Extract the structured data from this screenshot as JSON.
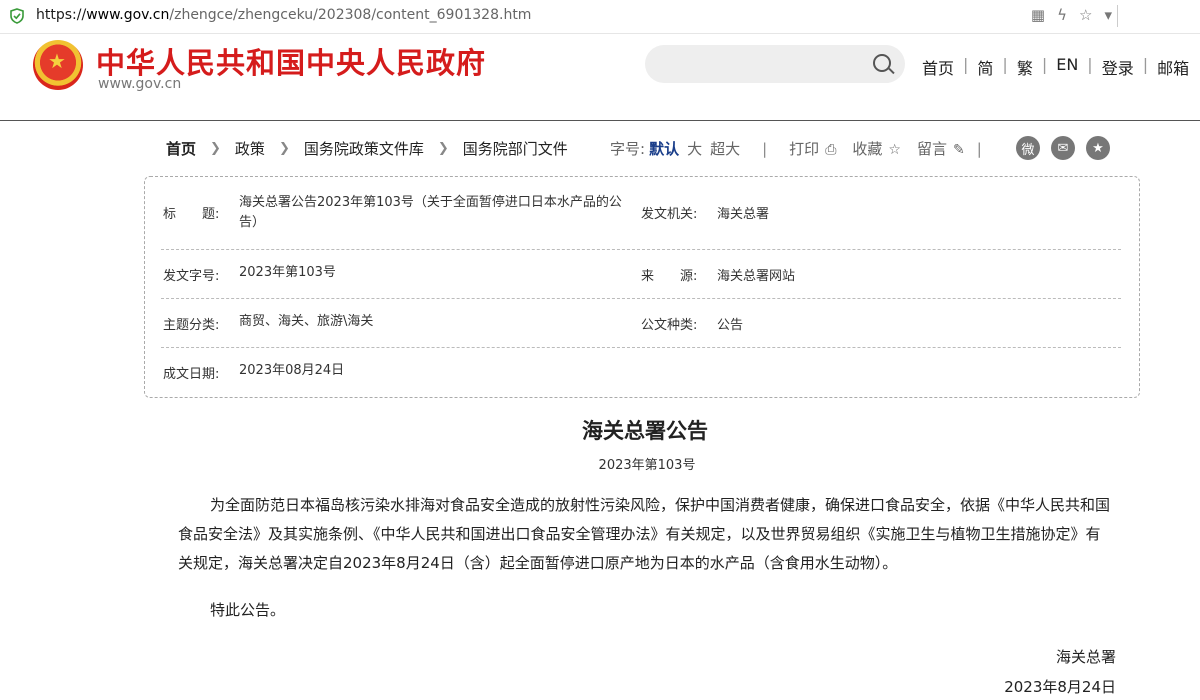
{
  "browser": {
    "url_scheme": "https://",
    "url_host": "www.gov.cn",
    "url_path": "/zhengce/zhengceku/202308/content_6901328.htm"
  },
  "header": {
    "site_title": "中华人民共和国中央人民政府",
    "domain": "www.gov.cn",
    "search_placeholder": "",
    "links": [
      "首页",
      "简",
      "繁",
      "EN",
      "登录",
      "邮箱"
    ],
    "separator": "|"
  },
  "breadcrumb": [
    "首页",
    "政策",
    "国务院政策文件库",
    "国务院部门文件"
  ],
  "tools": {
    "font_label": "字号:",
    "font_default": "默认",
    "font_large": "大",
    "font_xlarge": "超大",
    "print": "打印",
    "favorite": "收藏",
    "comment": "留言"
  },
  "meta": {
    "title_label": "标　　题:",
    "title_value": "海关总署公告2023年第103号（关于全面暂停进口日本水产品的公告）",
    "issuer_label": "发文机关:",
    "issuer_value": "海关总署",
    "docno_label": "发文字号:",
    "docno_value": "2023年第103号",
    "source_label": "来　　源:",
    "source_value": "海关总署网站",
    "topic_label": "主题分类:",
    "topic_value": "商贸、海关、旅游\\海关",
    "doctype_label": "公文种类:",
    "doctype_value": "公告",
    "date_label": "成文日期:",
    "date_value": "2023年08月24日"
  },
  "article": {
    "title": "海关总署公告",
    "subtitle": "2023年第103号",
    "paragraph": "为全面防范日本福岛核污染水排海对食品安全造成的放射性污染风险，保护中国消费者健康，确保进口食品安全，依据《中华人民共和国食品安全法》及其实施条例、《中华人民共和国进出口食品安全管理办法》有关规定，以及世界贸易组织《实施卫生与植物卫生措施协定》有关规定，海关总署决定自2023年8月24日（含）起全面暂停进口原产地为日本的水产品（含食用水生动物）。",
    "closing": "特此公告。",
    "signature": "海关总署",
    "date": "2023年8月24日"
  },
  "colors": {
    "brand_red": "#d51c1c",
    "link_blue": "#1a3e8a"
  }
}
